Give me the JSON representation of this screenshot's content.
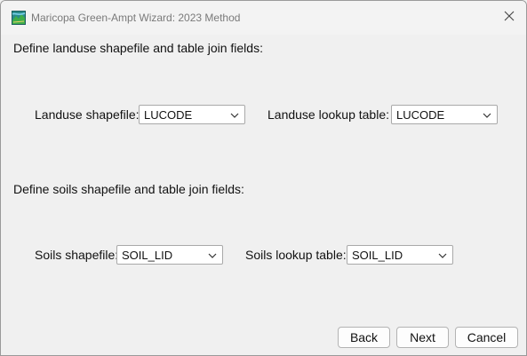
{
  "window": {
    "title": "Maricopa Green-Ampt Wizard: 2023 Method",
    "app_icon": "map-app-icon",
    "close_icon": "close-icon"
  },
  "landuse": {
    "heading": "Define landuse shapefile and table join fields:",
    "shapefile_label": "Landuse shapefile:",
    "shapefile_value": "LUCODE",
    "lookup_label": "Landuse lookup table:",
    "lookup_value": "LUCODE"
  },
  "soils": {
    "heading": "Define soils shapefile and table join fields:",
    "shapefile_label": "Soils shapefile:",
    "shapefile_value": "SOIL_LID",
    "lookup_label": "Soils lookup table:",
    "lookup_value": "SOIL_LID"
  },
  "buttons": {
    "back": "Back",
    "next": "Next",
    "cancel": "Cancel"
  },
  "colors": {
    "window_bg": "#f0f0f0",
    "input_bg": "#ffffff",
    "border": "#a9a9a9"
  }
}
